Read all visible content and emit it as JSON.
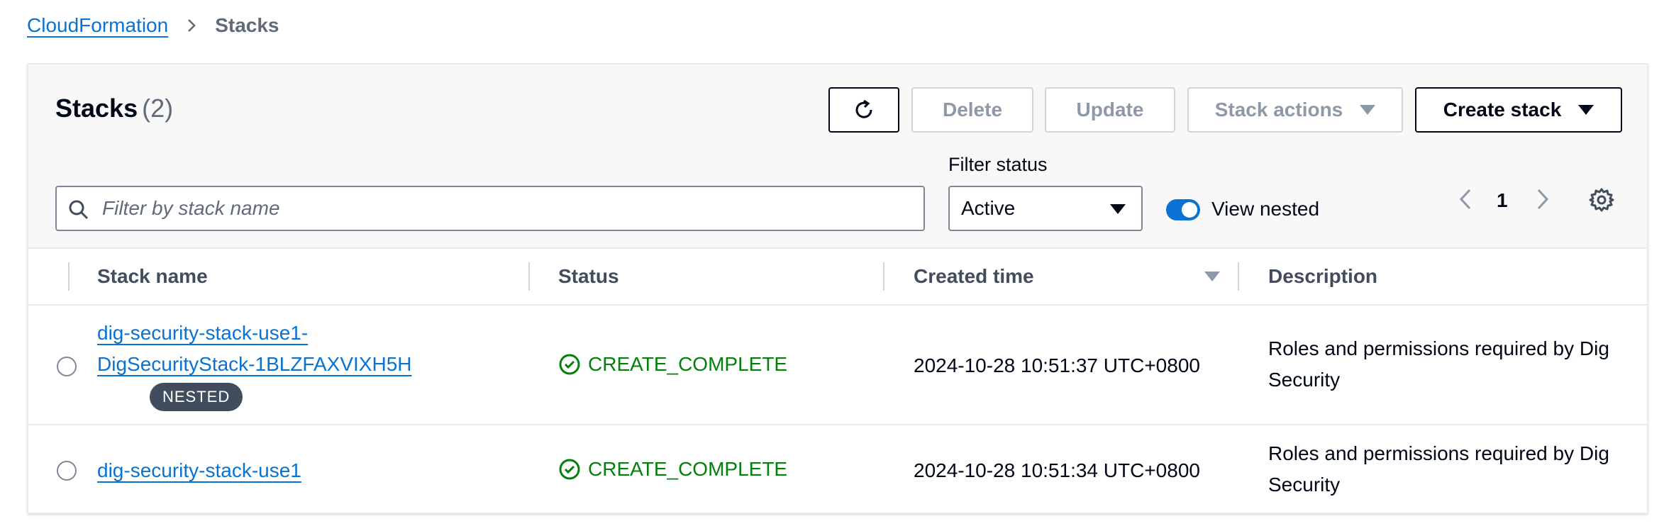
{
  "breadcrumb": {
    "root": "CloudFormation",
    "current": "Stacks"
  },
  "header": {
    "title": "Stacks",
    "count": "(2)"
  },
  "toolbar": {
    "delete_label": "Delete",
    "update_label": "Update",
    "stack_actions_label": "Stack actions",
    "create_stack_label": "Create stack"
  },
  "filters": {
    "search_placeholder": "Filter by stack name",
    "search_value": "",
    "status_label": "Filter status",
    "status_value": "Active",
    "view_nested_label": "View nested",
    "view_nested_on": true
  },
  "pagination": {
    "page": "1"
  },
  "table": {
    "columns": [
      "Stack name",
      "Status",
      "Created time",
      "Description"
    ],
    "sort_column": "Created time",
    "sort_direction": "descending",
    "rows": [
      {
        "name_line1": "dig-security-stack-use1-",
        "name_line2": "DigSecurityStack-1BLZFAXVIXH5H",
        "badge": "NESTED",
        "status": "CREATE_COMPLETE",
        "created": "2024-10-28 10:51:37 UTC+0800",
        "description_line1": "Roles and permissions required by Dig",
        "description_line2": "Security"
      },
      {
        "name": "dig-security-stack-use1",
        "status": "CREATE_COMPLETE",
        "created": "2024-10-28 10:51:34 UTC+0800",
        "description_line1": "Roles and permissions required by Dig",
        "description_line2": "Security"
      }
    ]
  },
  "colors": {
    "link": "#0972d3",
    "success": "#037f0c",
    "badge_bg": "#414d5c",
    "disabled_text": "#8d99a8"
  },
  "icons": [
    "chevron-right-icon",
    "refresh-icon",
    "caret-down-icon",
    "search-icon",
    "chevron-left-icon",
    "gear-icon",
    "status-success-icon",
    "sort-descending-icon"
  ]
}
